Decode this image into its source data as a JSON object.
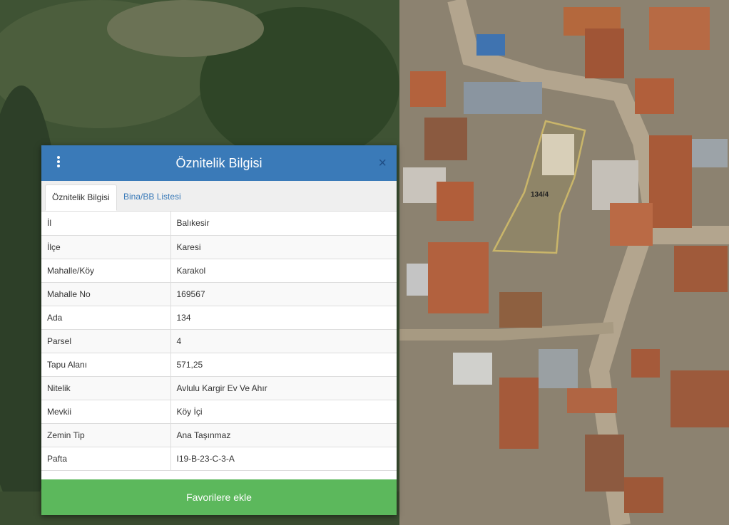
{
  "map": {
    "parcel_label": "134/4",
    "parcel_outline_color": "#c9b56a"
  },
  "panel": {
    "title": "Öznitelik Bilgisi",
    "close_label": "×",
    "header_color": "#3a7ab8",
    "tabs": [
      {
        "label": "Öznitelik Bilgisi",
        "active": true
      },
      {
        "label": "Bina/BB Listesi",
        "active": false
      }
    ],
    "rows": [
      {
        "key": "İl",
        "value": "Balıkesir"
      },
      {
        "key": "İlçe",
        "value": "Karesi"
      },
      {
        "key": "Mahalle/Köy",
        "value": "Karakol"
      },
      {
        "key": "Mahalle No",
        "value": "169567"
      },
      {
        "key": "Ada",
        "value": "134"
      },
      {
        "key": "Parsel",
        "value": "4"
      },
      {
        "key": "Tapu Alanı",
        "value": "571,25"
      },
      {
        "key": "Nitelik",
        "value": "Avlulu Kargir Ev Ve Ahır"
      },
      {
        "key": "Mevkii",
        "value": "Köy İçi"
      },
      {
        "key": "Zemin Tip",
        "value": "Ana Taşınmaz"
      },
      {
        "key": "Pafta",
        "value": "I19-B-23-C-3-A"
      }
    ],
    "favorite_button": "Favorilere ekle",
    "favorite_color": "#5cb85c"
  }
}
